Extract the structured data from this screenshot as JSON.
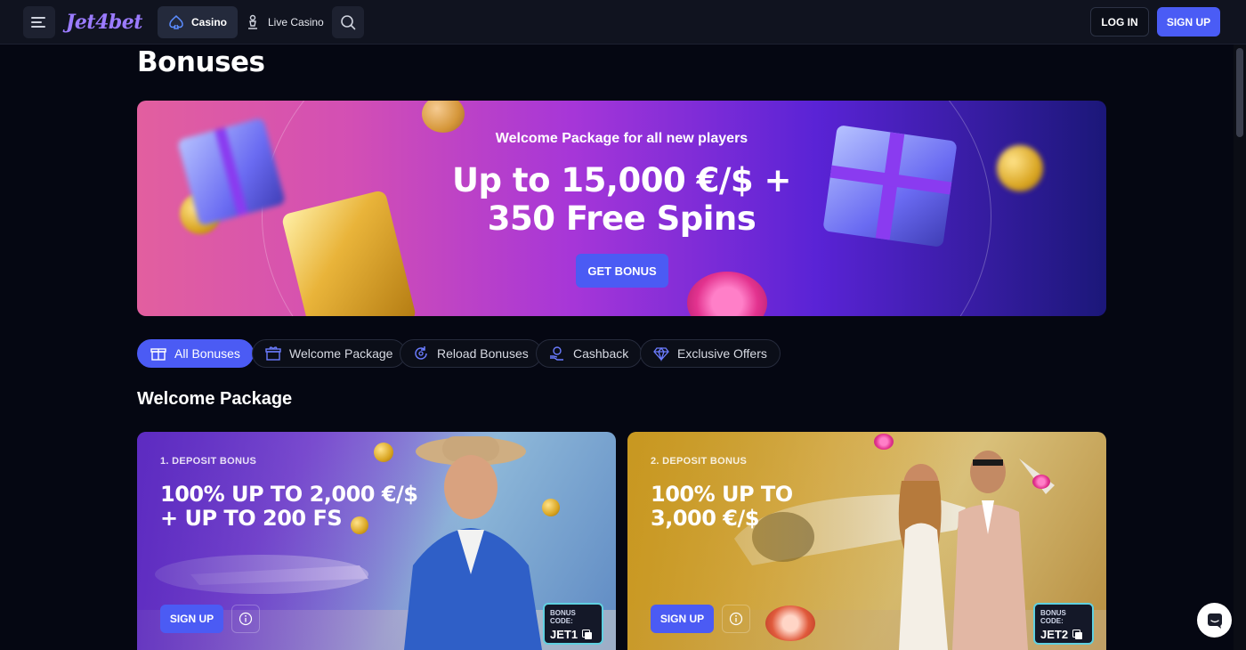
{
  "header": {
    "logo": "Jet4bet",
    "tabs": [
      {
        "label": "Casino",
        "icon": "spade-icon"
      },
      {
        "label": "Live Casino",
        "icon": "chess-pawn-icon"
      }
    ],
    "login_label": "LOG IN",
    "signup_label": "SIGN UP"
  },
  "page": {
    "title": "Bonuses"
  },
  "hero": {
    "subtitle": "Welcome Package for all new players",
    "title_line1": "Up to 15,000 €/$ +",
    "title_line2": "350 Free Spins",
    "button_label": "GET BONUS"
  },
  "filters": [
    {
      "label": "All Bonuses",
      "icon": "gift-icon",
      "active": true
    },
    {
      "label": "Welcome Package",
      "icon": "gift-box-icon",
      "active": false
    },
    {
      "label": "Reload Bonuses",
      "icon": "reload-icon",
      "active": false
    },
    {
      "label": "Cashback",
      "icon": "cashback-icon",
      "active": false
    },
    {
      "label": "Exclusive Offers",
      "icon": "diamond-icon",
      "active": false
    }
  ],
  "section": {
    "title": "Welcome Package"
  },
  "cards": [
    {
      "label": "1. DEPOSIT BONUS",
      "title": "100% UP TO 2,000 €/$\n+ UP TO 200 FS",
      "button_label": "SIGN UP",
      "code_label": "BONUS CODE:",
      "code": "JET1"
    },
    {
      "label": "2. DEPOSIT BONUS",
      "title": "100% UP TO\n3,000 €/$",
      "button_label": "SIGN UP",
      "code_label": "BONUS CODE:",
      "code": "JET2"
    }
  ],
  "colors": {
    "accent": "#4b5bf4",
    "background": "#050712",
    "header": "#10131f"
  }
}
